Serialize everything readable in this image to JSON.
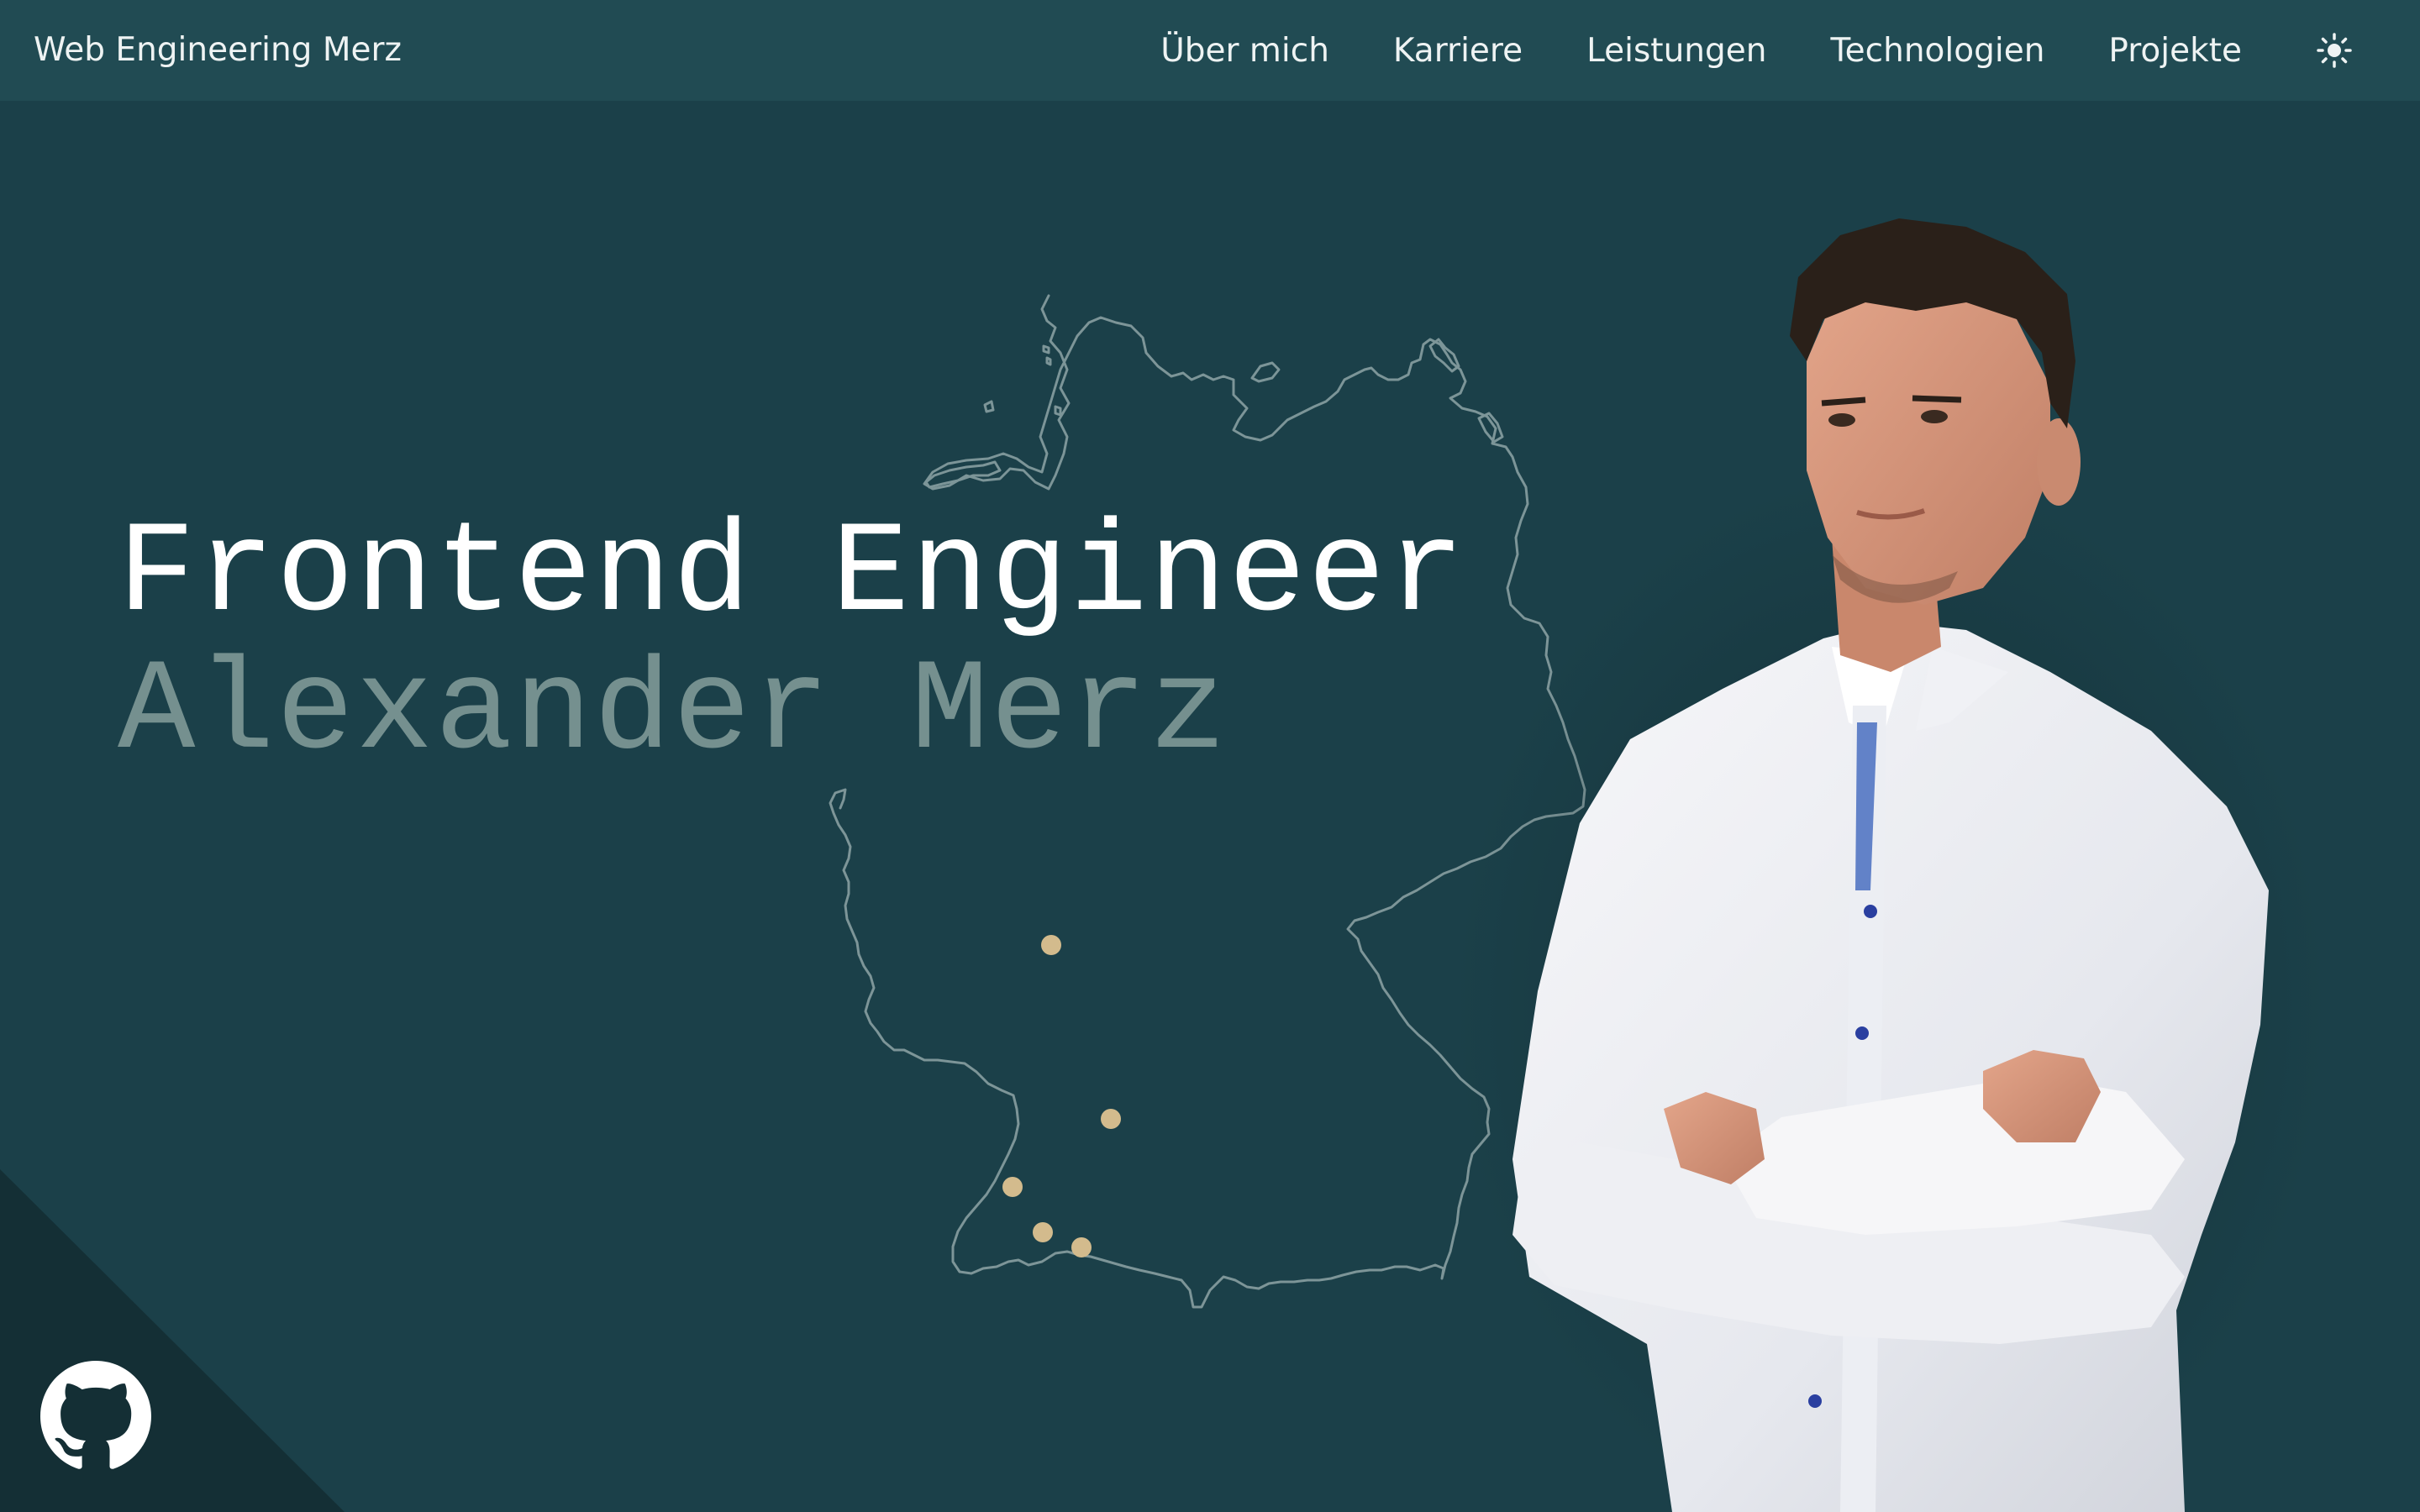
{
  "header": {
    "brand": "Web Engineering Merz",
    "nav": [
      {
        "label": "Über mich"
      },
      {
        "label": "Karriere"
      },
      {
        "label": "Leistungen"
      },
      {
        "label": "Technologien"
      },
      {
        "label": "Projekte"
      }
    ],
    "theme_toggle_icon": "sun-icon"
  },
  "hero": {
    "title": "Frontend Engineer",
    "name": "Alexander Merz"
  },
  "map": {
    "region": "germany-outline",
    "marker_count": 5
  },
  "footer": {
    "github_icon": "github-icon"
  },
  "colors": {
    "background": "#1b4049",
    "header": "#214b53",
    "corner": "#142f35",
    "marker": "#d3bb8d",
    "outline": "#8ea4a6",
    "name_muted": "#75908f"
  }
}
